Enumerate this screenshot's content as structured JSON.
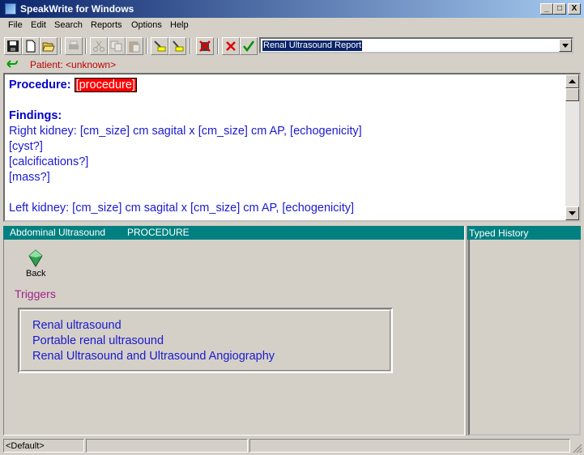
{
  "window": {
    "title": "SpeakWrite for Windows",
    "controls": {
      "minimize": "_",
      "maximize": "□",
      "close": "X"
    }
  },
  "menu": [
    "File",
    "Edit",
    "Search",
    "Reports",
    "Options",
    "Help"
  ],
  "toolbar": {
    "buttons": [
      {
        "name": "save-icon"
      },
      {
        "name": "new-document-icon"
      },
      {
        "name": "open-folder-icon"
      },
      {
        "name": "print-icon"
      },
      {
        "name": "cut-icon"
      },
      {
        "name": "copy-icon"
      },
      {
        "name": "paste-icon"
      },
      {
        "name": "marker-icon"
      },
      {
        "name": "marker-icon-2"
      },
      {
        "name": "delete-field-icon"
      },
      {
        "name": "cancel-x-icon"
      },
      {
        "name": "accept-check-icon"
      }
    ],
    "report_select": "Renal Ultrasound Report"
  },
  "patient": {
    "label": "Patient: <unknown>"
  },
  "editor": {
    "procedure_label": "Procedure:",
    "procedure_value": "[procedure]",
    "findings_label": "Findings:",
    "lines": [
      "Right kidney: [cm_size] cm sagital x [cm_size] cm AP, [echogenicity]",
      "[cyst?]",
      "[calcifications?]",
      "[mass?]",
      "",
      "Left kidney: [cm_size] cm sagital x [cm_size] cm AP, [echogenicity]"
    ]
  },
  "left_pane": {
    "header_section": "Abdominal Ultrasound",
    "header_type": "PROCEDURE",
    "back_label": "Back",
    "triggers_title": "Triggers",
    "triggers": [
      "Renal ultrasound",
      "Portable renal ultrasound",
      "Renal Ultrasound and Ultrasound Angiography"
    ]
  },
  "right_pane": {
    "header": "Typed History"
  },
  "statusbar": {
    "cell1": "<Default>",
    "cell2": "",
    "cell3": ""
  },
  "colors": {
    "title_gradient_start": "#0a246a",
    "pane_header": "#008080",
    "field_highlight": "#ff0000",
    "text_blue": "#1a1ad0",
    "patient_red": "#c00000",
    "triggers_purple": "#a0208a"
  }
}
